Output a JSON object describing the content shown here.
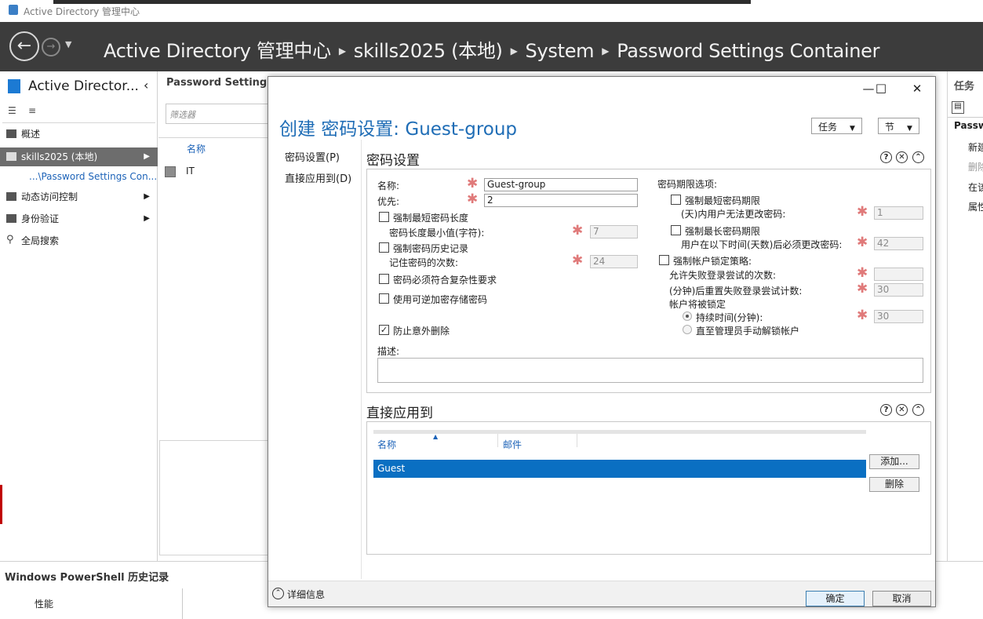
{
  "window": {
    "title": "Active Directory 管理中心"
  },
  "breadcrumb": {
    "items": [
      "Active Directory 管理中心",
      "skills2025 (本地)",
      "System",
      "Password Settings Container"
    ]
  },
  "left_pane": {
    "title": "Active Director...",
    "items": [
      {
        "label": "概述"
      },
      {
        "label": "skills2025 (本地)"
      },
      {
        "label": "...\\Password Settings Con..."
      },
      {
        "label": "动态访问控制"
      },
      {
        "label": "身份验证"
      },
      {
        "label": "全局搜索"
      }
    ]
  },
  "middle_pane": {
    "title": "Password Settings",
    "filter_placeholder": "筛选器",
    "column": "名称",
    "row": "IT"
  },
  "right_pane": {
    "title": "任务",
    "section": "Passw",
    "items": [
      "新建",
      "删除",
      "在该",
      "属性"
    ]
  },
  "bottom": {
    "powershell": "Windows PowerShell 历史记录",
    "perf": "性能"
  },
  "dialog": {
    "title": "创建 密码设置: Guest-group",
    "tasks_btn": "任务",
    "sections_btn": "节",
    "nav": [
      "密码设置(P)",
      "直接应用到(D)"
    ],
    "pwd_section": {
      "heading": "密码设置",
      "name_label": "名称:",
      "name_value": "Guest-group",
      "priority_label": "优先:",
      "priority_value": "2",
      "enforce_min_len": "强制最短密码长度",
      "min_len_label": "密码长度最小值(字符):",
      "min_len_value": "7",
      "enforce_history": "强制密码历史记录",
      "history_label": "记住密码的次数:",
      "history_value": "24",
      "complexity": "密码必须符合复杂性要求",
      "reversible": "使用可逆加密存储密码",
      "protect_delete": "防止意外删除",
      "description_label": "描述:",
      "age_options": "密码期限选项:",
      "enforce_min_age": "强制最短密码期限",
      "min_age_label": "(天)内用户无法更改密码:",
      "min_age_value": "1",
      "enforce_max_age": "强制最长密码期限",
      "max_age_label": "用户在以下时间(天数)后必须更改密码:",
      "max_age_value": "42",
      "lockout_policy": "强制帐户锁定策略:",
      "failed_attempts_label": "允许失败登录尝试的次数:",
      "failed_attempts_value": "",
      "reset_label": "(分钟)后重置失败登录尝试计数:",
      "reset_value": "30",
      "locked_label": "帐户将被锁定",
      "duration_label": "持续时间(分钟):",
      "duration_value": "30",
      "until_admin_label": "直至管理员手动解锁帐户"
    },
    "apply_section": {
      "heading": "直接应用到",
      "col_name": "名称",
      "col_mail": "邮件",
      "rows": [
        "Guest"
      ],
      "add_btn": "添加...",
      "remove_btn": "删除"
    },
    "footer": {
      "details": "详细信息",
      "ok": "确定",
      "cancel": "取消"
    }
  },
  "colors": {
    "accent": "#1f6db6",
    "selection": "#0a6fc2",
    "navbar": "#3c3c3c"
  }
}
